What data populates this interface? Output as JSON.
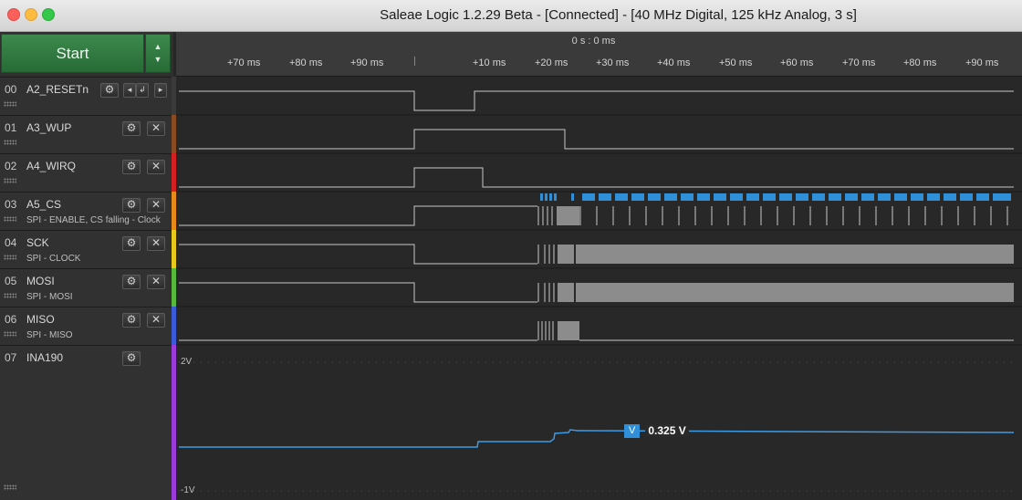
{
  "window": {
    "title": "Saleae Logic 1.2.29 Beta - [Connected] - [40 MHz Digital, 125 kHz Analog, 3 s]"
  },
  "controls": {
    "start_label": "Start",
    "arrow_up": "▲",
    "arrow_down": "▼"
  },
  "channels": [
    {
      "num": "00",
      "name": "A2_RESETn",
      "sub": "",
      "color": "#3a3a3a"
    },
    {
      "num": "01",
      "name": "A3_WUP",
      "sub": "",
      "color": "#8a4a22"
    },
    {
      "num": "02",
      "name": "A4_WIRQ",
      "sub": "",
      "color": "#d42020"
    },
    {
      "num": "03",
      "name": "A5_CS",
      "sub": "SPI - ENABLE, CS falling - Clock",
      "color": "#e88a1a"
    },
    {
      "num": "04",
      "name": "SCK",
      "sub": "SPI - CLOCK",
      "color": "#e8c81a"
    },
    {
      "num": "05",
      "name": "MOSI",
      "sub": "SPI - MOSI",
      "color": "#58b83a"
    },
    {
      "num": "06",
      "name": "MISO",
      "sub": "SPI - MISO",
      "color": "#3a5ad8"
    },
    {
      "num": "07",
      "name": "INA190",
      "sub": "",
      "color": "#9a3ad8"
    }
  ],
  "icons": {
    "gear": "⚙",
    "close": "✕",
    "prev": "◂",
    "edge": "↲",
    "next": "▸"
  },
  "ruler": {
    "origin": "0 s : 0 ms",
    "ticks": [
      "+70 ms",
      "+80 ms",
      "+90 ms",
      "+10 ms",
      "+20 ms",
      "+30 ms",
      "+40 ms",
      "+50 ms",
      "+60 ms",
      "+70 ms",
      "+80 ms",
      "+90 ms"
    ]
  },
  "analog": {
    "top_label": "2V",
    "bottom_label": "-1V",
    "marker_label": "V",
    "marker_value": "0.325 V"
  }
}
